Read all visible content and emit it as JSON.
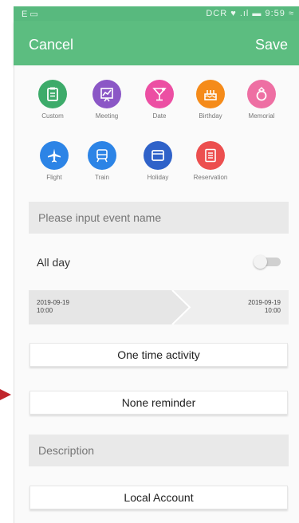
{
  "statusbar": {
    "left": "E ▭",
    "right": "DCR ♥ .ıl ▬ 9:59 ≈"
  },
  "header": {
    "cancel_label": "Cancel",
    "save_label": "Save"
  },
  "categories": [
    {
      "label": "Custom",
      "icon": "clipboard-icon",
      "color": "#3dab6a"
    },
    {
      "label": "Meeting",
      "icon": "chart-icon",
      "color": "#8b57c6"
    },
    {
      "label": "Date",
      "icon": "cocktail-icon",
      "color": "#ec4fa3"
    },
    {
      "label": "Birthday",
      "icon": "cake-icon",
      "color": "#f58b1a"
    },
    {
      "label": "Memorial",
      "icon": "ring-icon",
      "color": "#ee6fa3"
    },
    {
      "label": "Flight",
      "icon": "airplane-icon",
      "color": "#2c84e6"
    },
    {
      "label": "Train",
      "icon": "train-icon",
      "color": "#2c84e6"
    },
    {
      "label": "Holiday",
      "icon": "calendar-icon",
      "color": "#2f62c9"
    },
    {
      "label": "Reservation",
      "icon": "document-icon",
      "color": "#ec4f4f"
    }
  ],
  "form": {
    "event_name_placeholder": "Please input event name",
    "allday_label": "All day",
    "start_date": "2019-09-19",
    "start_time": "10:00",
    "end_date": "2019-09-19",
    "end_time": "10:00",
    "repeat_label": "One time activity",
    "reminder_label": "None reminder",
    "description_placeholder": "Description",
    "account_label": "Local Account"
  },
  "colors": {
    "header": "#5cbd80",
    "arrow": "#c0262c"
  }
}
